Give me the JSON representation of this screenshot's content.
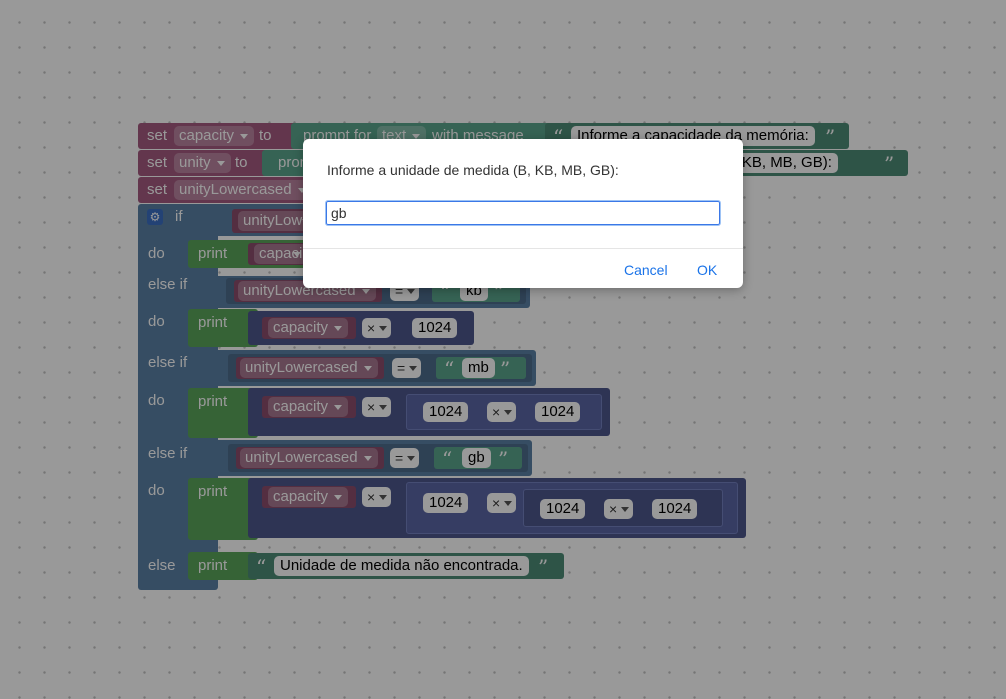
{
  "blocks": {
    "set1": {
      "kw": "set",
      "var": "capacity",
      "to": "to",
      "prompt": "prompt for",
      "type": "text",
      "with": "with message",
      "msg": "Informe a capacidade da memória:"
    },
    "set2": {
      "kw": "set",
      "var": "unity",
      "to": "to",
      "prompt": "prom",
      "msg_tail": "a (B, KB, MB, GB):"
    },
    "set3": {
      "kw": "set",
      "var": "unityLowercased"
    },
    "if": {
      "label": "if",
      "cond_var": "unityLowe"
    },
    "do1": {
      "label": "do",
      "print": "print",
      "arg": "capaci"
    },
    "elseif1": {
      "label": "else if",
      "var": "unityLowercased",
      "op": "=",
      "val": "kb"
    },
    "do2": {
      "label": "do",
      "print": "print",
      "var": "capacity",
      "op": "×",
      "num": "1024"
    },
    "elseif2": {
      "label": "else if",
      "var": "unityLowercased",
      "op": "=",
      "val": "mb"
    },
    "do3": {
      "label": "do",
      "print": "print",
      "var": "capacity",
      "op": "×",
      "num1": "1024",
      "op2": "×",
      "num2": "1024"
    },
    "elseif3": {
      "label": "else if",
      "var": "unityLowercased",
      "op": "=",
      "val": "gb"
    },
    "do4": {
      "label": "do",
      "print": "print",
      "var": "capacity",
      "op": "×",
      "num1": "1024",
      "op2": "×",
      "num2": "1024",
      "op3": "×",
      "num3": "1024"
    },
    "else": {
      "label": "else",
      "print": "print",
      "msg": "Unidade de medida não encontrada."
    }
  },
  "dialog": {
    "message": "Informe a unidade de medida (B, KB, MB, GB):",
    "input_value": "gb",
    "cancel": "Cancel",
    "ok": "OK"
  },
  "colors": {
    "variables": "#a55b80",
    "logic": "#5b80a5",
    "text": "#5ba58c",
    "math": "#5b67a5",
    "print": "#5ba55b",
    "link": "#1a73e8"
  }
}
